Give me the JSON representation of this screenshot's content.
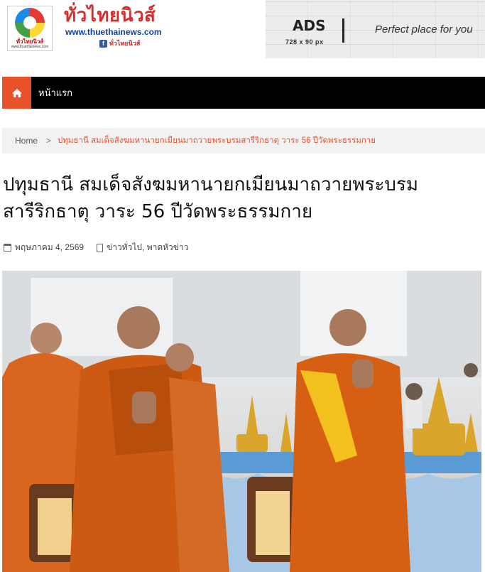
{
  "header": {
    "logo_small_text": "ทั่วไทยนิวส์",
    "logo_small_url": "www.thuethainews.com",
    "brand_name": "ทั่วไทยนิวส์",
    "brand_url": "www.thuethainews.com",
    "fb_letter": "f",
    "fb_name": "ทั่วไทยนิวส์"
  },
  "ad": {
    "label": "ADS",
    "size": "728 x 90 px",
    "tagline": "Perfect place for you"
  },
  "nav": {
    "home_icon": "home-icon",
    "items": [
      {
        "label": "หน้าแรก"
      }
    ]
  },
  "breadcrumb": {
    "home": "Home",
    "separator": ">",
    "current": "ปทุมธานี สมเด็จสังฆมหานายกเมียนมาถวายพระบรมสารีริกธาตุ วาระ 56 ปีวัดพระธรรมกาย"
  },
  "article": {
    "title": "ปทุมธานี สมเด็จสังฆมหานายกเมียนมาถวายพระบรมสารีริกธาตุ วาระ 56 ปีวัดพระธรรมกาย",
    "date": "พฤษภาคม 4, 2569",
    "categories": "ข่าวทั่วไป, พาดหัวข่าว"
  },
  "colors": {
    "accent": "#e8512a",
    "nav_bg": "#000000",
    "brand_red": "#d32f2f",
    "brand_blue": "#0d3fa8"
  }
}
